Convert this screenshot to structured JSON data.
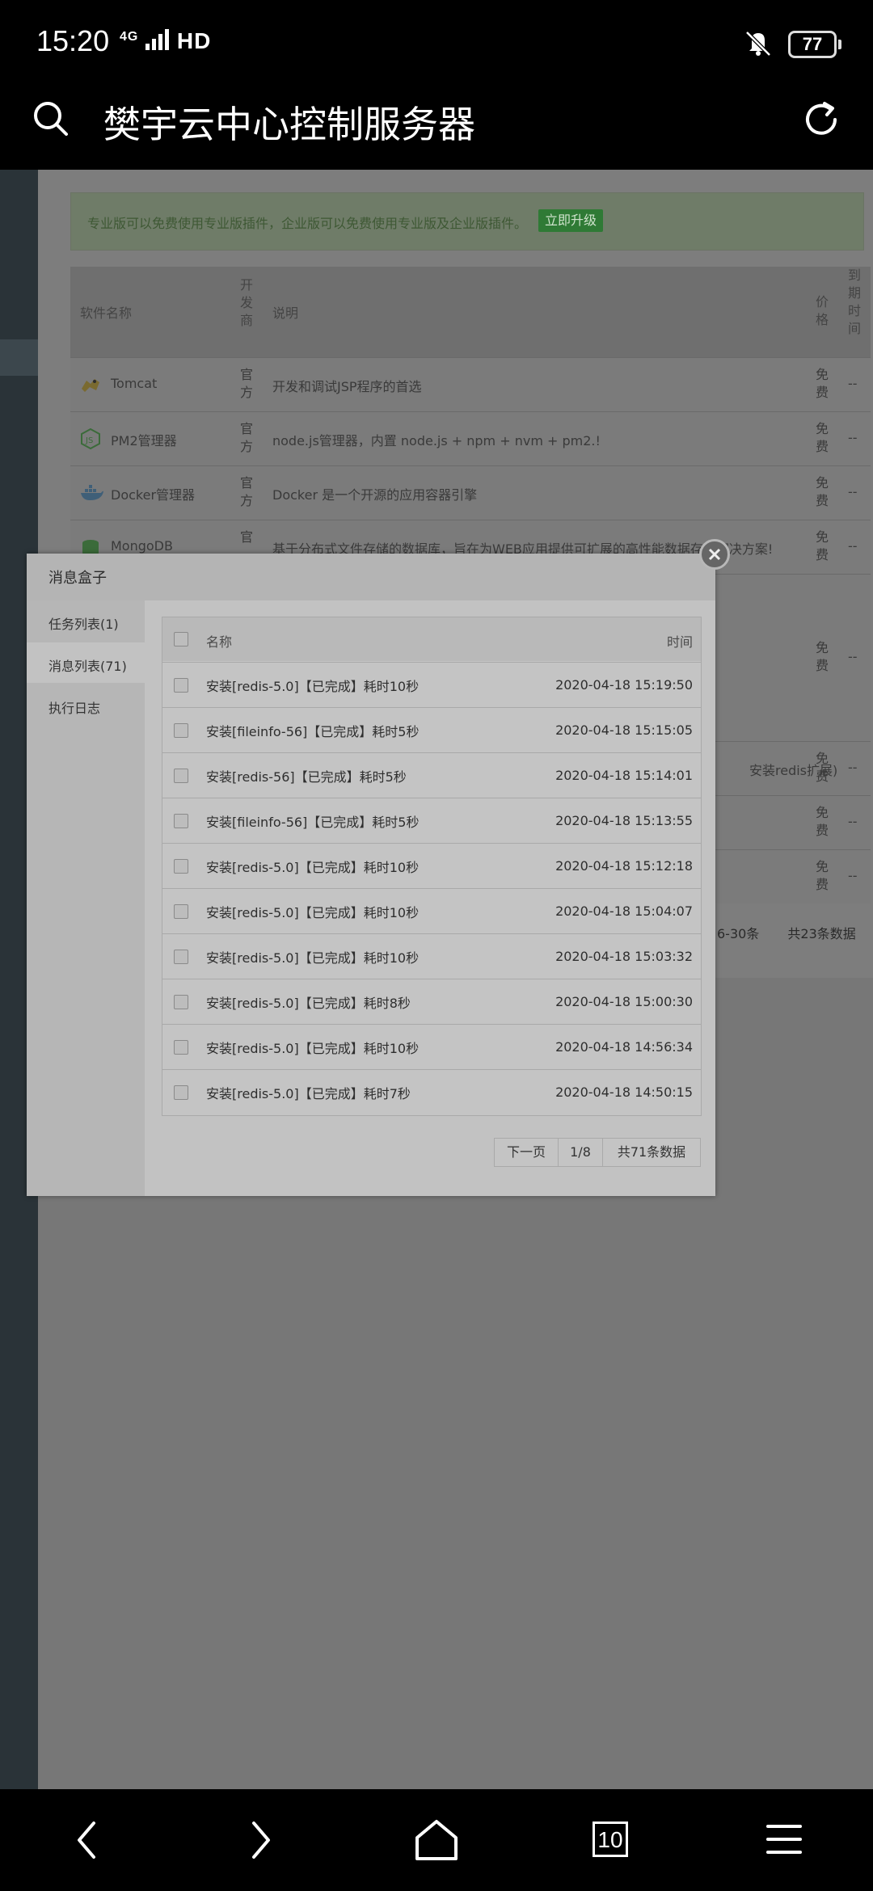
{
  "status_bar": {
    "time": "15:20",
    "network": "4G",
    "signal_label": "HD",
    "battery": "77"
  },
  "title_bar": {
    "title": "樊宇云中心控制服务器"
  },
  "notice": {
    "text": "专业版可以免费使用专业版插件，企业版可以免费使用专业版及企业版插件。",
    "button": "立即升级"
  },
  "table": {
    "headers": {
      "name": "软件名称",
      "developer": "开发商",
      "description": "说明",
      "price": "价格",
      "expire": "到期时间"
    },
    "rows": [
      {
        "name": "Tomcat",
        "developer": "官方",
        "description": "开发和调试JSP程序的首选",
        "price": "免费",
        "expire": "--"
      },
      {
        "name": "PM2管理器",
        "developer": "官方",
        "description": "node.js管理器，内置 node.js + npm + nvm + pm2.!",
        "price": "免费",
        "expire": "--"
      },
      {
        "name": "Docker管理器",
        "developer": "官方",
        "description": "Docker 是一个开源的应用容器引擎",
        "price": "免费",
        "expire": "--"
      },
      {
        "name": "MongoDB",
        "developer": "官",
        "description": "基于分布式文件存储的数据库，旨在为WEB应用提供可扩展的高性能数据存储解决方案!",
        "price": "免费",
        "expire": "--"
      }
    ],
    "hidden_rows": [
      {
        "description": "安装redis扩展)",
        "price": "免费",
        "expire": "--"
      },
      {
        "price": "免费",
        "expire": "--"
      },
      {
        "price": "免费",
        "expire": "--"
      },
      {
        "price": "免费",
        "expire": "--"
      }
    ],
    "pagination": {
      "range": "6-30条",
      "total": "共23条数据"
    }
  },
  "modal": {
    "title": "消息盒子",
    "side_items": [
      "任务列表(1)",
      "消息列表(71)",
      "执行日志"
    ],
    "list_headers": {
      "name": "名称",
      "time": "时间"
    },
    "messages": [
      {
        "text": "安装[redis-5.0]【已完成】耗时10秒",
        "time": "2020-04-18 15:19:50"
      },
      {
        "text": "安装[fileinfo-56]【已完成】耗时5秒",
        "time": "2020-04-18 15:15:05"
      },
      {
        "text": "安装[redis-56]【已完成】耗时5秒",
        "time": "2020-04-18 15:14:01"
      },
      {
        "text": "安装[fileinfo-56]【已完成】耗时5秒",
        "time": "2020-04-18 15:13:55"
      },
      {
        "text": "安装[redis-5.0]【已完成】耗时10秒",
        "time": "2020-04-18 15:12:18"
      },
      {
        "text": "安装[redis-5.0]【已完成】耗时10秒",
        "time": "2020-04-18 15:04:07"
      },
      {
        "text": "安装[redis-5.0]【已完成】耗时10秒",
        "time": "2020-04-18 15:03:32"
      },
      {
        "text": "安装[redis-5.0]【已完成】耗时8秒",
        "time": "2020-04-18 15:00:30"
      },
      {
        "text": "安装[redis-5.0]【已完成】耗时10秒",
        "time": "2020-04-18 14:56:34"
      },
      {
        "text": "安装[redis-5.0]【已完成】耗时7秒",
        "time": "2020-04-18 14:50:15"
      }
    ],
    "pager": {
      "next": "下一页",
      "page": "1/8",
      "total": "共71条数据"
    }
  },
  "bottom_nav": {
    "tabs_count": "10"
  }
}
